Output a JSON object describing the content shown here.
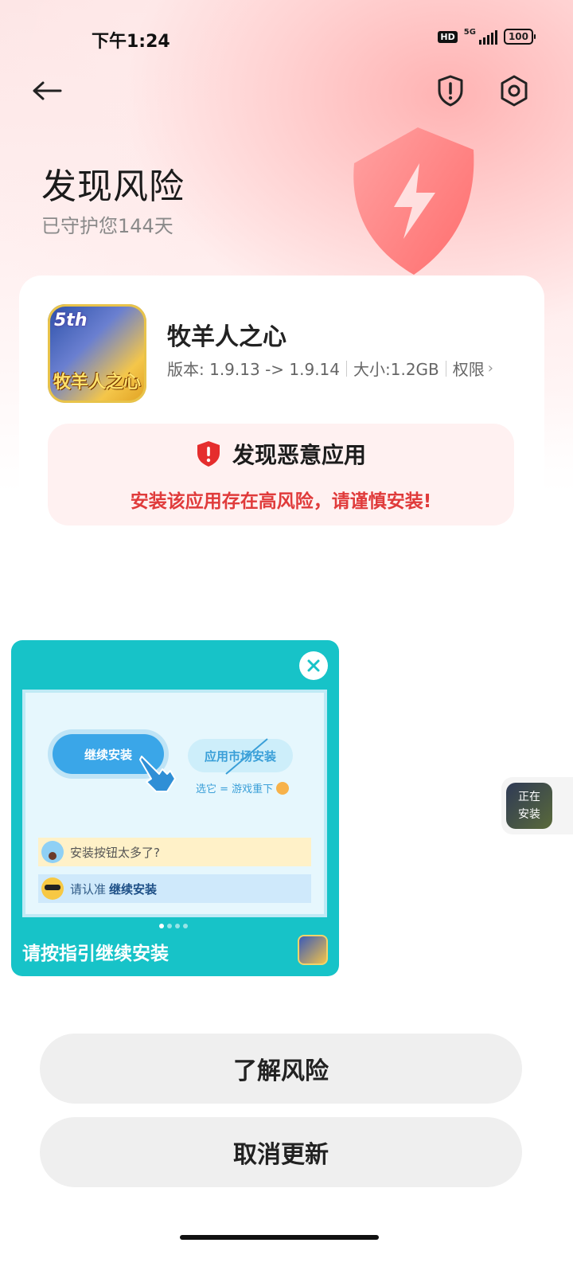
{
  "status_bar": {
    "time": "下午1:24",
    "hd": "HD",
    "network": "5G",
    "battery": "100"
  },
  "header": {
    "icons": [
      "back-arrow-icon",
      "shield-alert-icon",
      "settings-icon"
    ]
  },
  "hero": {
    "title": "发现风险",
    "subtitle": "已守护您144天"
  },
  "app": {
    "name": "牧羊人之心",
    "icon_badge": "5th",
    "icon_logo": "牧羊人之心",
    "version": "版本: 1.9.13 -> 1.9.14",
    "size": "大小:1.2GB",
    "permissions": "权限"
  },
  "warning": {
    "title": "发现恶意应用",
    "text": "安装该应用存在高风险，请谨慎安装!",
    "color": "#e03b3b"
  },
  "guide": {
    "continue_label": "继续安装",
    "market_label": "应用市场安装",
    "market_note": "选它 = 游戏重下",
    "tip1": "安装按钮太多了?",
    "tip2_prefix": "请认准",
    "tip2_highlight": "继续安装",
    "caption": "请按指引继续安装",
    "accent": "#17c3c8",
    "pages": 4,
    "current_page": 1
  },
  "floating": {
    "line1": "正在",
    "line2": "安装"
  },
  "actions": {
    "learn_risk": "了解风险",
    "cancel_update": "取消更新"
  }
}
